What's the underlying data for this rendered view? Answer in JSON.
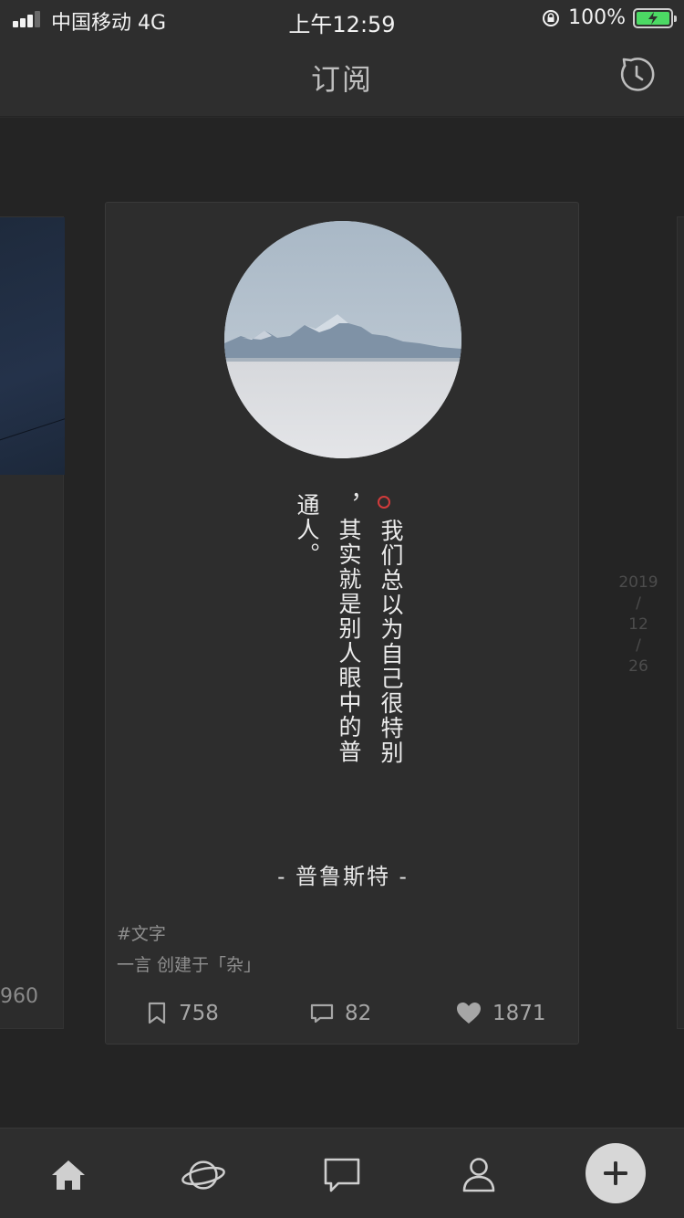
{
  "status_bar": {
    "carrier": "中国移动 4G",
    "time": "上午12:59",
    "battery": "100%"
  },
  "nav": {
    "title": "订阅",
    "history_icon": "history-clock-icon"
  },
  "side_cards": {
    "left_count": "960"
  },
  "date": {
    "year": "2019",
    "sep1": "/",
    "month": "12",
    "sep2": "/",
    "day": "26"
  },
  "card": {
    "image_icon": "landscape-photo",
    "quote_lines": [
      "我们总以为自己很特别",
      "，其实就是别人眼中的普",
      "通人。"
    ],
    "author": "- 普鲁斯特 -",
    "tag": "#文字",
    "creator": "一言 创建于「杂」",
    "stats": {
      "bookmarks": "758",
      "comments": "82",
      "likes": "1871"
    }
  },
  "tabs": [
    {
      "icon": "home-icon"
    },
    {
      "icon": "planet-icon"
    },
    {
      "icon": "chat-bubble-icon"
    },
    {
      "icon": "user-icon"
    },
    {
      "icon": "plus-icon"
    }
  ],
  "colors": {
    "accent_red": "#d23b3b",
    "background": "#242424",
    "card": "#2d2d2d"
  }
}
